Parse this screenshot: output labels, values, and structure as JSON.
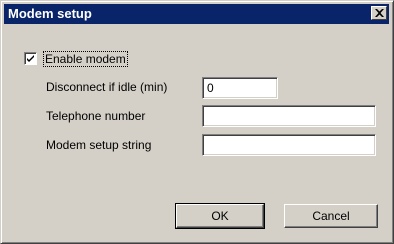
{
  "window": {
    "title": "Modem setup",
    "close_icon": "close-x-icon"
  },
  "enable_modem": {
    "label": "Enable modem",
    "checked": true
  },
  "fields": {
    "idle": {
      "label": "Disconnect if idle (min)",
      "value": "0"
    },
    "phone": {
      "label": "Telephone number",
      "value": ""
    },
    "setup": {
      "label": "Modem setup string",
      "value": ""
    }
  },
  "buttons": {
    "ok": "OK",
    "cancel": "Cancel"
  },
  "colors": {
    "titlebar": "#0a246a",
    "face": "#d4d0c8"
  }
}
